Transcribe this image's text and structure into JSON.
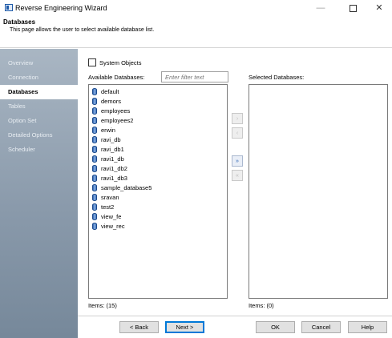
{
  "window": {
    "title": "Reverse Engineering Wizard",
    "minimize": "—",
    "close": "✕"
  },
  "header": {
    "title": "Databases",
    "subtitle": "This page allows the user to select available database list."
  },
  "sidebar": {
    "items": [
      {
        "label": "Overview"
      },
      {
        "label": "Connection"
      },
      {
        "label": "Databases"
      },
      {
        "label": "Tables"
      },
      {
        "label": "Option Set"
      },
      {
        "label": "Detailed Options"
      },
      {
        "label": "Scheduler"
      }
    ],
    "active_index": 2
  },
  "main": {
    "system_objects_label": "System Objects",
    "system_objects_checked": false,
    "available_label": "Available Databases:",
    "filter_placeholder": "Enter filter text",
    "selected_label": "Selected Databases:",
    "available_databases": [
      "default",
      "demors",
      "employees",
      "employees2",
      "erwin",
      "ravi_db",
      "ravi_db1",
      "ravi1_db",
      "ravi1_db2",
      "ravi1_db3",
      "sample_database5",
      "sravan",
      "test2",
      "view_fe",
      "view_rec"
    ],
    "selected_databases": [],
    "available_count": "Items: (15)",
    "selected_count": "Items: (0)",
    "transfer_buttons": [
      {
        "icon": "move-right-icon",
        "glyph": "›",
        "enabled": false
      },
      {
        "icon": "move-left-icon",
        "glyph": "‹",
        "enabled": false
      },
      {
        "icon": "move-all-right-icon",
        "glyph": "»",
        "enabled": true
      },
      {
        "icon": "move-all-left-icon",
        "glyph": "«",
        "enabled": false
      }
    ]
  },
  "footer": {
    "back": "< Back",
    "next": "Next >",
    "ok": "OK",
    "cancel": "Cancel",
    "help": "Help"
  }
}
